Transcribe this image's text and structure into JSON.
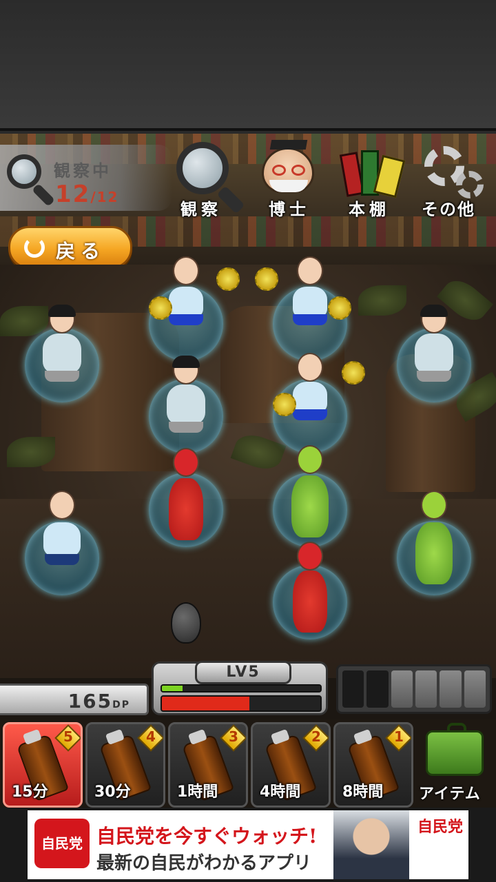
{
  "header": {
    "observing_label": "観察中",
    "observing_count": "12",
    "observing_total": "/12",
    "nav": [
      {
        "label": "観察",
        "icon": "magnifier-icon"
      },
      {
        "label": "博士",
        "icon": "professor-icon"
      },
      {
        "label": "本棚",
        "icon": "books-icon"
      },
      {
        "label": "その他",
        "icon": "gears-icon"
      }
    ],
    "back_label": "戻る"
  },
  "status": {
    "dp_value": "165",
    "dp_unit": "DP",
    "level": "LV5",
    "xp_fraction": 0.13,
    "growth_fraction": 0.55,
    "slots_filled": 2,
    "slots_total": 6
  },
  "items": [
    {
      "count": "5",
      "time": "15分",
      "active": true
    },
    {
      "count": "4",
      "time": "30分",
      "active": false
    },
    {
      "count": "3",
      "time": "1時間",
      "active": false
    },
    {
      "count": "2",
      "time": "4時間",
      "active": false
    },
    {
      "count": "1",
      "time": "8時間",
      "active": false
    }
  ],
  "item_box_label": "アイテム",
  "ad": {
    "logo": "自民党",
    "line1": "自民党を今すぐウォッチ!",
    "line2": "最新の自民がわかるアプリ",
    "brand": "自民党"
  },
  "colors": {
    "accent_orange": "#f5a623",
    "counter_red": "#c6402a",
    "xp_green": "#7cd322",
    "growth_red": "#e02a1a",
    "ad_red": "#d4161c"
  }
}
